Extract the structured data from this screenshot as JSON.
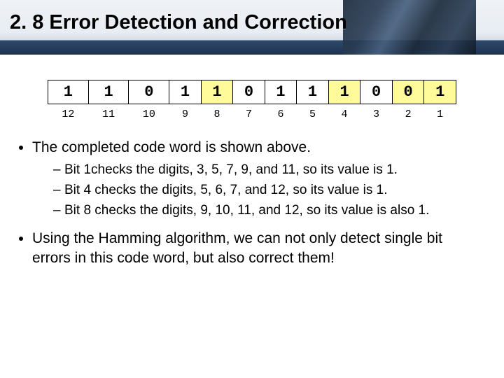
{
  "header": {
    "title": "2. 8 Error Detection and Correction"
  },
  "codeword": {
    "cells": [
      {
        "bit": "1",
        "pos": "12",
        "parity": false
      },
      {
        "bit": "1",
        "pos": "11",
        "parity": false
      },
      {
        "bit": "0",
        "pos": "10",
        "parity": false
      },
      {
        "bit": "1",
        "pos": "9",
        "parity": false
      },
      {
        "bit": "1",
        "pos": "8",
        "parity": true
      },
      {
        "bit": "0",
        "pos": "7",
        "parity": false
      },
      {
        "bit": "1",
        "pos": "6",
        "parity": false
      },
      {
        "bit": "1",
        "pos": "5",
        "parity": false
      },
      {
        "bit": "1",
        "pos": "4",
        "parity": true
      },
      {
        "bit": "0",
        "pos": "3",
        "parity": false
      },
      {
        "bit": "0",
        "pos": "2",
        "parity": true
      },
      {
        "bit": "1",
        "pos": "1",
        "parity": true
      }
    ]
  },
  "bullets": {
    "b1": "The completed code word is shown above.",
    "b1sub": [
      "Bit 1checks the digits, 3, 5, 7, 9, and 11, so its value is 1.",
      "Bit 4 checks the digits, 5, 6, 7, and 12, so its value is 1.",
      "Bit 8 checks the digits, 9, 10, 11, and 12, so its value is also 1."
    ],
    "b2": "Using the Hamming algorithm, we can not only detect single bit errors in this code word, but also correct them!"
  }
}
